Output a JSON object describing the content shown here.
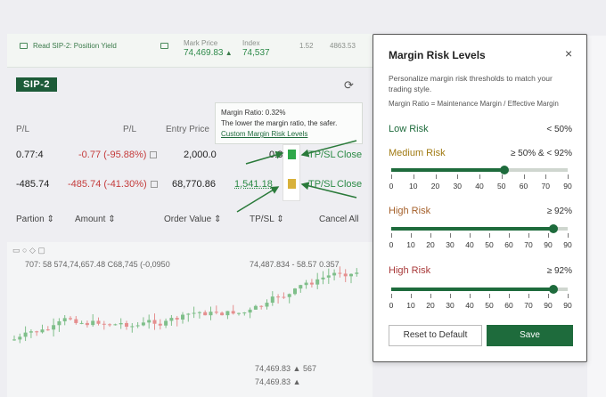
{
  "topbar": {
    "read": "Read SIP-2: Position Yield",
    "mark_label": "Mark Price",
    "mark_value": "74,469.83",
    "mark_arrow": "▲",
    "index_label": "Index",
    "index_value": "74,537",
    "v1": "1.52",
    "v2": "4863.53"
  },
  "sip": "SIP-2",
  "headers": {
    "pl1": "P/L",
    "pl2": "P/L",
    "entry": "Entry Price"
  },
  "tooltip": {
    "line1": "Margin Ratio: 0.32%",
    "line2": "The lower the margin ratio, the safer.",
    "link": "Custom Margin Risk Levels"
  },
  "rows": [
    {
      "pl": "0.77:4",
      "pl2": "-0.77 (-95.88%)",
      "entry": "2,000.0",
      "val": "0.8",
      "tpsl": "TP/SL",
      "close": "Close"
    },
    {
      "pl": "-485.74",
      "pl2": "-485.74 (-41.30%)",
      "entry": "68,770.86",
      "val": "1,541.18",
      "tpsl": "TP/SL",
      "close": "Close"
    }
  ],
  "columns": {
    "partion": "Partion",
    "amount": "Amount",
    "order_value": "Order Value",
    "tpsl": "TP/SL",
    "cancel_all": "Cancel All"
  },
  "chart_header": {
    "a": "707: 58",
    "b": "574,74,657.48",
    "c": "C68,745",
    "d": "(-0,0950",
    "e": "74,487.834 - 58.57",
    "f": "0.357"
  },
  "chart_bottom": {
    "p1": "74,469.83",
    "p2": "567",
    "p3": "74,469.83",
    "p4": "▲"
  },
  "panel": {
    "title": "Margin Risk Levels",
    "close": "×",
    "desc": "Personalize margin risk thresholds to match your trading style.",
    "formula": "Margin Ratio = Maintenance Margin / Effective Margin",
    "low": {
      "label": "Low Risk",
      "value": "< 50%"
    },
    "medium": {
      "label": "Medium Risk",
      "value": "≥ 50% & < 92%",
      "slider_fraction": 0.64,
      "ticks": [
        "0",
        "10",
        "20",
        "30",
        "40",
        "50",
        "60",
        "70",
        "90"
      ]
    },
    "high1": {
      "label": "High Risk",
      "value": "≥ 92%",
      "slider_fraction": 0.92,
      "ticks": [
        "0",
        "10",
        "20",
        "30",
        "40",
        "50",
        "60",
        "70",
        "90",
        "90"
      ]
    },
    "high2": {
      "label": "High Risk",
      "value": "≥ 92%",
      "slider_fraction": 0.92,
      "ticks": [
        "0",
        "10",
        "20",
        "30",
        "40",
        "50",
        "60",
        "70",
        "90",
        "90"
      ]
    },
    "reset": "Reset to Default",
    "save": "Save"
  },
  "colors": {
    "accent": "#1e6b3c",
    "medium": "#a07a12",
    "high": "#a5602a",
    "danger": "#c43b3b",
    "low": "#1e6b3c"
  }
}
